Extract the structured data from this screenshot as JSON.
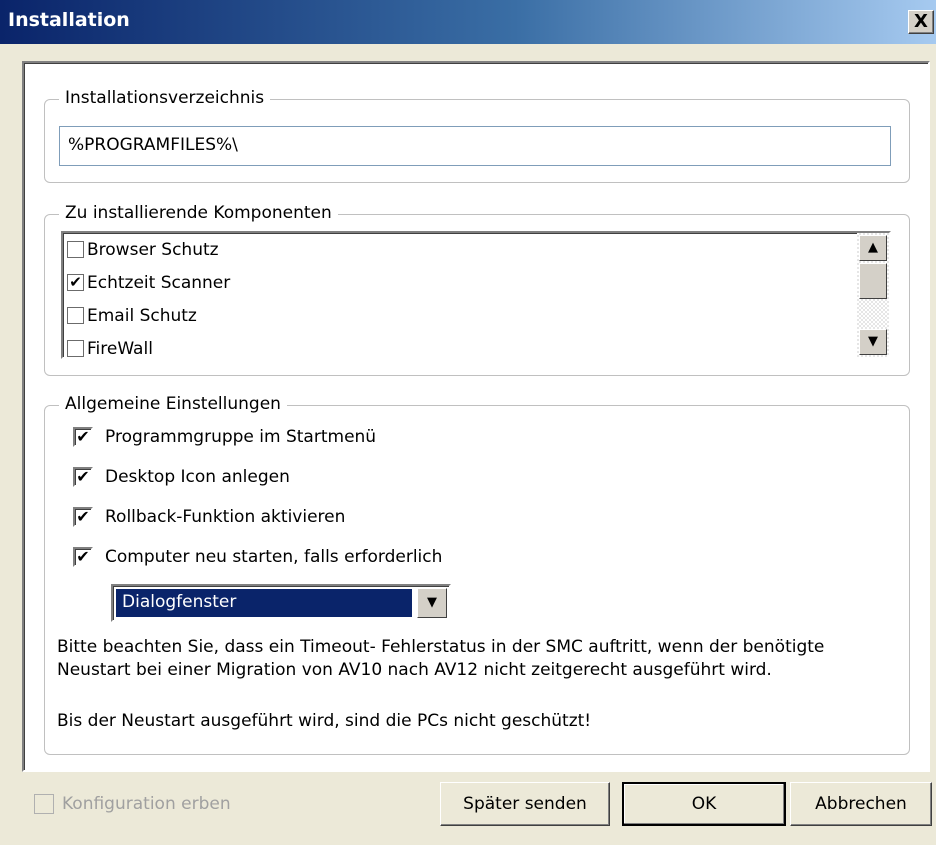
{
  "window": {
    "title": "Installation",
    "close_glyph": "X"
  },
  "install_dir": {
    "legend": "Installationsverzeichnis",
    "value": "%PROGRAMFILES%\\"
  },
  "components": {
    "legend": "Zu installierende Komponenten",
    "items": [
      {
        "label": "Browser Schutz",
        "checked": false,
        "mark": ""
      },
      {
        "label": "Echtzeit Scanner",
        "checked": true,
        "mark": "✔"
      },
      {
        "label": "Email Schutz",
        "checked": false,
        "mark": ""
      },
      {
        "label": "FireWall",
        "checked": false,
        "mark": ""
      }
    ]
  },
  "general": {
    "legend": "Allgemeine Einstellungen",
    "options": [
      {
        "label": "Programmgruppe im Startmenü",
        "checked": true,
        "mark": "✔"
      },
      {
        "label": "Desktop Icon anlegen",
        "checked": true,
        "mark": "✔"
      },
      {
        "label": "Rollback-Funktion aktivieren",
        "checked": true,
        "mark": "✔"
      },
      {
        "label": "Computer neu starten, falls erforderlich",
        "checked": true,
        "mark": "✔"
      }
    ],
    "restart_mode": {
      "selected": "Dialogfenster"
    },
    "note_line1": "Bitte beachten Sie, dass ein Timeout- Fehlerstatus in der SMC auftritt, wenn der benötigte Neustart bei einer Migration von AV10 nach AV12 nicht zeitgerecht ausgeführt wird.",
    "note_line2": "Bis der Neustart ausgeführt wird, sind die PCs nicht geschützt!"
  },
  "footer": {
    "inherit_config_label": "Konfiguration erben",
    "inherit_config_checked": false,
    "send_later_label": "Später senden",
    "ok_label": "OK",
    "cancel_label": "Abbrechen"
  },
  "colors": {
    "title_gradient_start": "#0a246a",
    "selection": "#0a246a",
    "dialog_bg": "#ece9d8"
  }
}
